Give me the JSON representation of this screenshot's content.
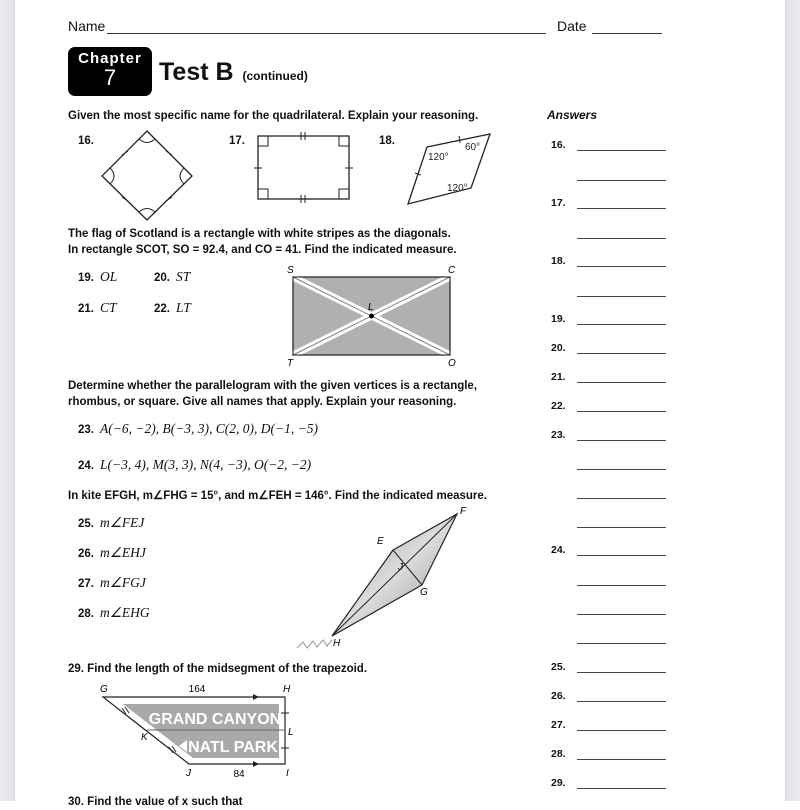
{
  "header": {
    "name_label": "Name",
    "date_label": "Date",
    "chapter_word": "Chapter",
    "chapter_number": "7",
    "title": "Test B",
    "title_suffix": "(continued)"
  },
  "answers_header": "Answers",
  "section1": {
    "instruction": "Given the most specific name for the quadrilateral. Explain your reasoning.",
    "items": [
      {
        "num": "16."
      },
      {
        "num": "17."
      },
      {
        "num": "18.",
        "angles": [
          "120°",
          "60°",
          "120°"
        ]
      }
    ]
  },
  "section2": {
    "instruction_line1": "The flag of Scotland is a rectangle with white stripes as the diagonals.",
    "instruction_line2": "In rectangle SCOT, SO = 92.4, and CO = 41. Find the indicated measure.",
    "items": [
      {
        "num": "19.",
        "expr": "OL"
      },
      {
        "num": "20.",
        "expr": "ST"
      },
      {
        "num": "21.",
        "expr": "CT"
      },
      {
        "num": "22.",
        "expr": "LT"
      }
    ],
    "figure_labels": {
      "S": "S",
      "C": "C",
      "O": "O",
      "T": "T",
      "L": "L"
    }
  },
  "section3": {
    "instruction_line1": "Determine whether the parallelogram with the given vertices is a rectangle,",
    "instruction_line2": "rhombus, or square. Give all names that apply. Explain your reasoning.",
    "items": [
      {
        "num": "23.",
        "expr": "A(−6, −2), B(−3, 3), C(2, 0), D(−1, −5)"
      },
      {
        "num": "24.",
        "expr": "L(−3, 4), M(3, 3), N(4, −3), O(−2, −2)"
      }
    ]
  },
  "section4": {
    "instruction": "In kite EFGH, m∠FHG = 15°, and m∠FEH = 146°. Find the indicated measure.",
    "items": [
      {
        "num": "25.",
        "expr": "m∠FEJ"
      },
      {
        "num": "26.",
        "expr": "m∠EHJ"
      },
      {
        "num": "27.",
        "expr": "m∠FGJ"
      },
      {
        "num": "28.",
        "expr": "m∠EHG"
      }
    ],
    "figure_labels": {
      "E": "E",
      "F": "F",
      "G": "G",
      "H": "H",
      "J": "J"
    }
  },
  "section5": {
    "instruction": "29. Find the length of the midsegment of the trapezoid.",
    "top_length": "164",
    "bottom_length": "84",
    "sign_line1": "GRAND CANYON",
    "sign_line2": "NATL PARK",
    "figure_labels": {
      "G": "G",
      "H": "H",
      "K": "K",
      "L": "L",
      "J": "J",
      "I": "I"
    }
  },
  "section6_cutoff": "30. Find the value of x such that",
  "answer_rows": [
    {
      "num": "16."
    },
    {
      "num": ""
    },
    {
      "num": "17."
    },
    {
      "num": ""
    },
    {
      "num": "18."
    },
    {
      "num": ""
    },
    {
      "num": "19."
    },
    {
      "num": "20."
    },
    {
      "num": "21."
    },
    {
      "num": "22."
    },
    {
      "num": "23."
    },
    {
      "num": ""
    },
    {
      "num": ""
    },
    {
      "num": ""
    },
    {
      "num": "24."
    },
    {
      "num": ""
    },
    {
      "num": ""
    },
    {
      "num": ""
    },
    {
      "num": "25."
    },
    {
      "num": "26."
    },
    {
      "num": "27."
    },
    {
      "num": "28."
    },
    {
      "num": "29."
    }
  ]
}
